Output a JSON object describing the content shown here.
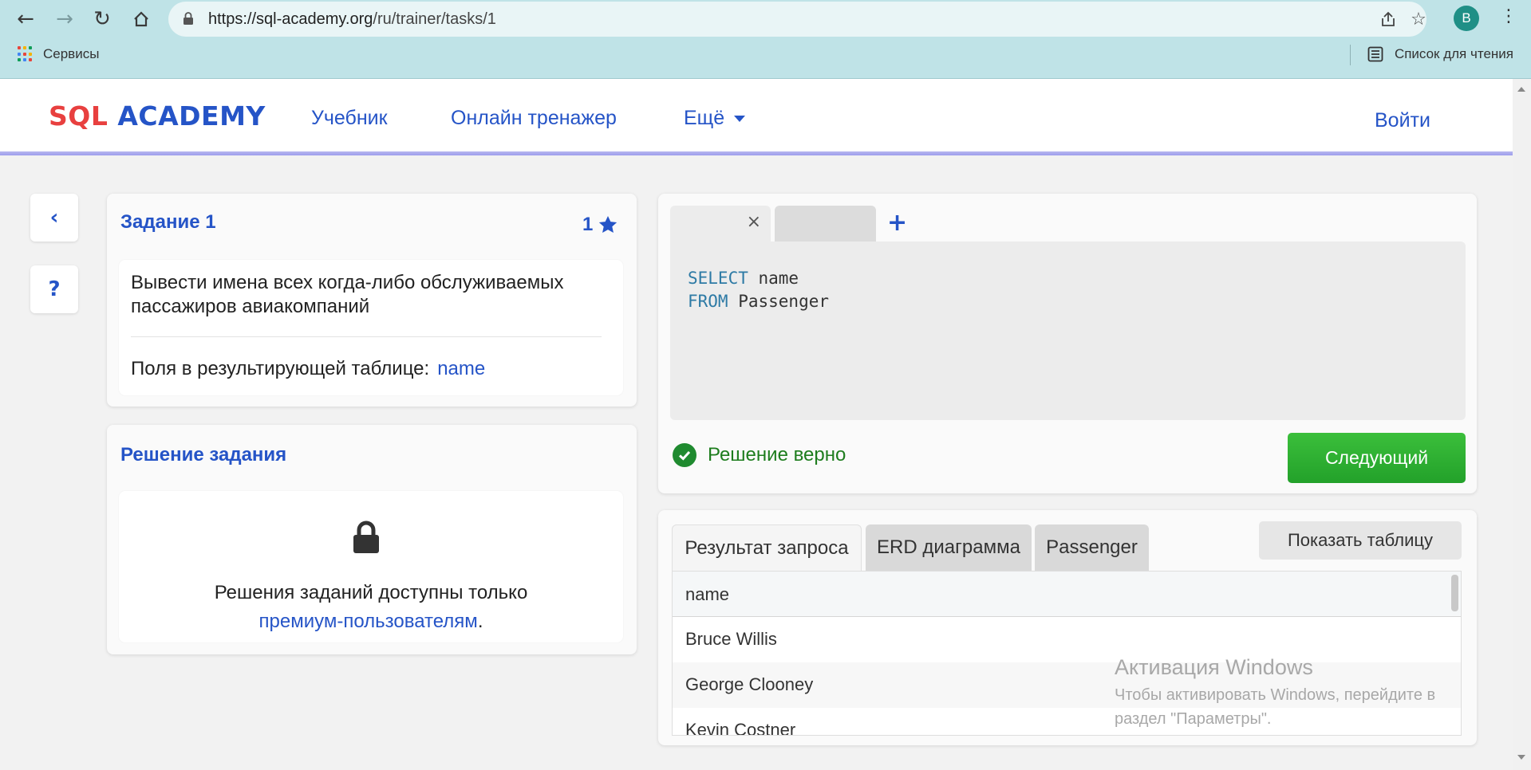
{
  "browser": {
    "url_host": "https://sql-academy.org",
    "url_path": "/ru/trainer/tasks/1",
    "profile_initial": "В",
    "bookmark_services": "Сервисы",
    "reading_list": "Список для чтения"
  },
  "header": {
    "logo_sql": "SQL",
    "logo_academy": "ACADEMY",
    "nav_tutorial": "Учебник",
    "nav_trainer": "Онлайн тренажер",
    "nav_more": "Ещё",
    "login": "Войти"
  },
  "task": {
    "title": "Задание 1",
    "rating": "1",
    "description": "Вывести имена всех когда-либо обслуживаемых пассажиров авиакомпаний",
    "fields_label": "Поля в результирующей таблице:",
    "fields_value": "name"
  },
  "solution": {
    "title": "Решение задания",
    "text": "Решения заданий доступны только",
    "link": "премиум-пользователям",
    "after_link": "."
  },
  "editor": {
    "line1_kw": "SELECT",
    "line1_rest": " name",
    "line2_kw": "FROM",
    "line2_rest": " Passenger",
    "status": "Решение верно",
    "next_button": "Следующий"
  },
  "results": {
    "tabs": [
      "Результат запроса",
      "ERD диаграмма",
      "Passenger"
    ],
    "show_table": "Показать таблицу",
    "column": "name",
    "rows": [
      "Bruce Willis",
      "George Clooney",
      "Kevin Costner"
    ]
  },
  "watermark": {
    "title": "Активация Windows",
    "line1": "Чтобы активировать Windows, перейдите в",
    "line2": "раздел \"Параметры\"."
  },
  "colors": {
    "accent": "#2554c7",
    "logo_red": "#e8403f",
    "success": "#1f8a2f",
    "chrome": "#bfe3e7"
  }
}
